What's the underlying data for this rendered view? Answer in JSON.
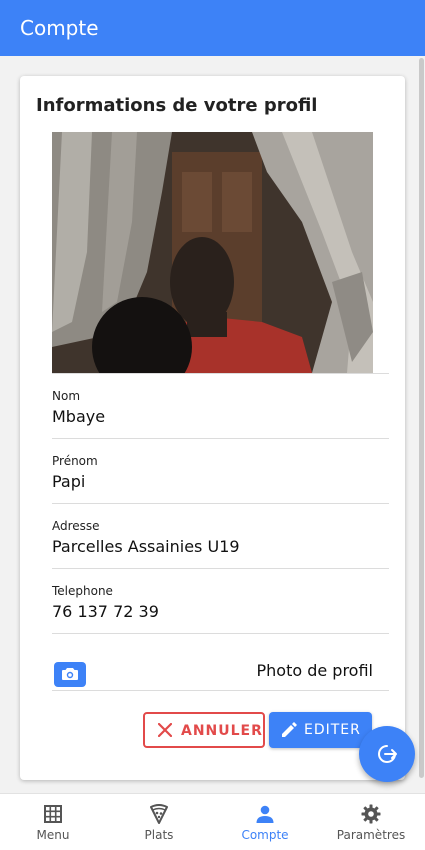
{
  "appbar": {
    "title": "Compte"
  },
  "card": {
    "title": "Informations de votre profil",
    "fields": [
      {
        "label": "Nom",
        "value": "Mbaye"
      },
      {
        "label": "Prénom",
        "value": "Papi"
      },
      {
        "label": "Adresse",
        "value": "Parcelles Assainies U19"
      },
      {
        "label": "Telephone",
        "value": "76 137 72 39"
      }
    ],
    "photo_label": "Photo de profil",
    "photo_icon": "camera-icon",
    "cancel_label": "ANNULER",
    "edit_label": "EDITER"
  },
  "fab": {
    "icon": "logout-icon"
  },
  "bottom_nav": [
    {
      "label": "Menu",
      "icon": "grid-icon",
      "active": false
    },
    {
      "label": "Plats",
      "icon": "pizza-icon",
      "active": false
    },
    {
      "label": "Compte",
      "icon": "person-icon",
      "active": true
    },
    {
      "label": "Paramètres",
      "icon": "gear-icon",
      "active": false
    }
  ],
  "colors": {
    "primary": "#3d82f7",
    "danger": "#e24a4a",
    "inactive": "#555555"
  }
}
